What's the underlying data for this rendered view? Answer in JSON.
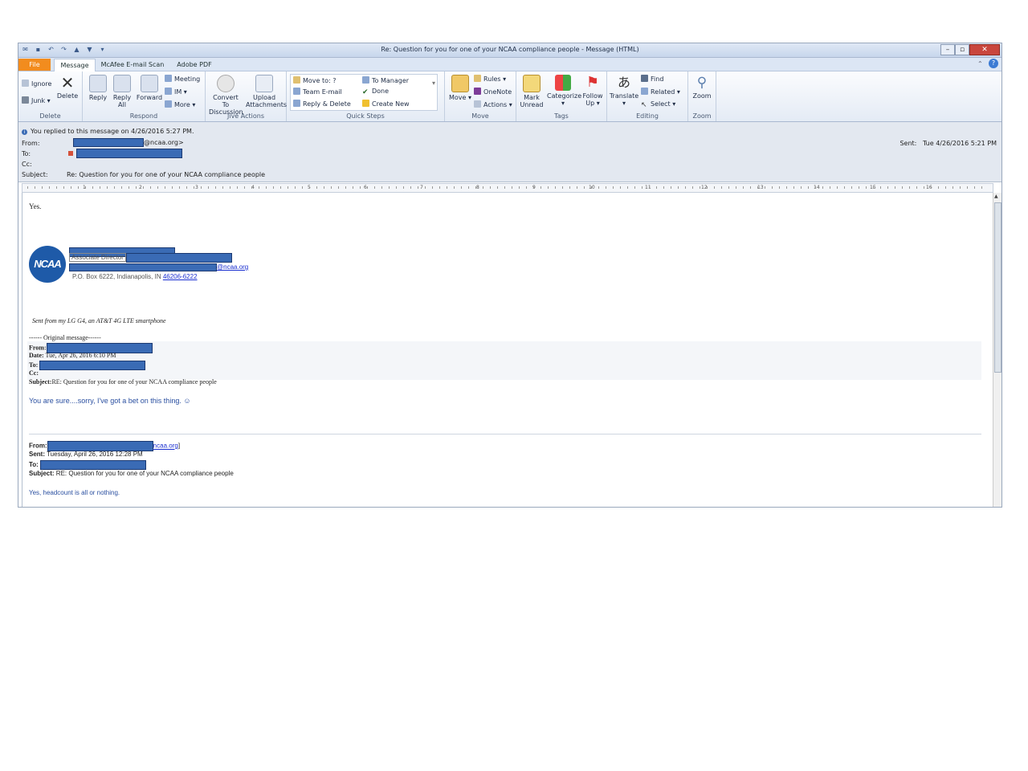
{
  "window": {
    "title": "Re: Question for you for one of your NCAA compliance people - Message (HTML)",
    "qat_icons": [
      "envelope-icon",
      "save-icon",
      "undo-icon",
      "redo-icon",
      "up-arrow-icon",
      "down-arrow-icon",
      "customize-icon"
    ],
    "controls": [
      "–",
      "▫",
      "✕"
    ]
  },
  "tabs": [
    "File",
    "Message",
    "McAfee E-mail Scan",
    "Adobe PDF"
  ],
  "ribbon": {
    "delete": {
      "label": "Delete",
      "ignore": "Ignore",
      "junk": "Junk",
      "delete": "Delete"
    },
    "respond": {
      "label": "Respond",
      "reply": "Reply",
      "reply_all": "Reply All",
      "forward": "Forward",
      "meeting": "Meeting",
      "im": "IM",
      "more": "More"
    },
    "live_actions": {
      "label": "Jive Actions",
      "convert": "Convert To Discussion",
      "upload": "Upload Attachments"
    },
    "quick_steps": {
      "label": "Quick Steps",
      "move_to": "Move to: ?",
      "team_email": "Team E-mail",
      "reply_delete": "Reply & Delete",
      "to_manager": "To Manager",
      "done": "Done",
      "create_new": "Create New"
    },
    "move": {
      "label": "Move",
      "move": "Move",
      "rules": "Rules",
      "onenote": "OneNote",
      "actions": "Actions"
    },
    "tags": {
      "label": "Tags",
      "mark_unread": "Mark Unread",
      "categorize": "Categorize",
      "follow_up": "Follow Up"
    },
    "editing": {
      "label": "Editing",
      "translate": "Translate",
      "find": "Find",
      "related": "Related",
      "select": "Select"
    },
    "zoom": {
      "label": "Zoom",
      "zoom": "Zoom"
    }
  },
  "header": {
    "info": "You replied to this message on 4/26/2016 5:27 PM.",
    "from_label": "From:",
    "from_suffix": "@ncaa.org>",
    "to_label": "To:",
    "cc_label": "Cc:",
    "subject_label": "Subject:",
    "subject": "Re: Question for you for one of your NCAA compliance people",
    "sent_label": "Sent:",
    "sent": "Tue 4/26/2016 5:21 PM"
  },
  "ruler": [
    "1",
    "2",
    "3",
    "4",
    "5",
    "6",
    "7",
    "8",
    "9",
    "10",
    "11",
    "12",
    "13",
    "14",
    "15",
    "16"
  ],
  "body": {
    "reply": "Yes.",
    "signature": {
      "logo": "NCAA",
      "title": "Associate Director",
      "email_suffix": "@ncaa.org",
      "address": "P.O. Box 6222, Indianapolis, IN ",
      "zip": "46206-6222"
    },
    "sent_from": "Sent from my LG G4, an AT&T 4G LTE smartphone",
    "original_marker": "------ Original message------",
    "orig1": {
      "from_label": "From:",
      "date_label": "Date:",
      "date": "Tue, Apr 26, 2016 6:10 PM",
      "to_label": "To:",
      "cc_label": "Cc:",
      "subject_label": "Subject:",
      "subject": "RE: Question for you for one of your NCAA compliance people",
      "message": "You are sure....sorry, I've got a bet on this thing.  ☺"
    },
    "orig2": {
      "from_label": "From:",
      "from_suffix": "ncaa.org",
      "sent_label": "Sent:",
      "sent": "Tuesday, April 26, 2016 12:28 PM",
      "to_label": "To:",
      "subject_label": "Subject:",
      "subject": "RE: Question for you for one of your NCAA compliance people",
      "message": "Yes, headcount is all or nothing."
    }
  }
}
